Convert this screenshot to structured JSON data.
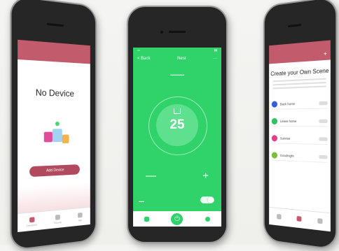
{
  "left_phone": {
    "header_text": "",
    "title": "No Device",
    "button_label": "Add Device",
    "tabs": [
      {
        "label": "Devices",
        "color": "#c25b6c"
      },
      {
        "label": "Scene",
        "color": "#bbbbbb"
      },
      {
        "label": "Me",
        "color": "#bbbbbb"
      }
    ]
  },
  "center_phone": {
    "back_label": "< Back",
    "nav_title": "Nest",
    "mode_label": "",
    "temperature": "25",
    "minus": "—",
    "plus": "+",
    "power_icon": "⏻"
  },
  "right_phone": {
    "title": "Create your Own Scene",
    "scenes": [
      {
        "label": "Back home",
        "color": "#3b5bd9"
      },
      {
        "label": "Leave home",
        "color": "#2fc35f"
      },
      {
        "label": "Sunrise",
        "color": "#e0418a"
      },
      {
        "label": "Goodnight",
        "color": "#7bbf3a"
      }
    ]
  },
  "colors": {
    "accent_pink": "#c25b6c",
    "accent_green": "#2fd36a"
  }
}
